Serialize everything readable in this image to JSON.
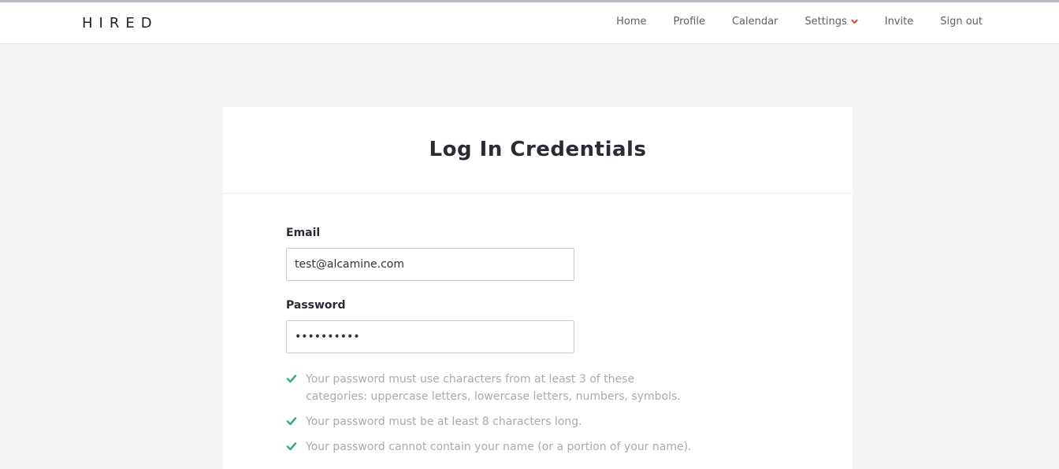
{
  "brand": {
    "logo_text": "HIRED"
  },
  "nav": {
    "items": [
      {
        "label": "Home"
      },
      {
        "label": "Profile"
      },
      {
        "label": "Calendar"
      },
      {
        "label": "Settings",
        "has_dropdown": true
      },
      {
        "label": "Invite"
      },
      {
        "label": "Sign out"
      }
    ],
    "dropdown_icon": "chevron-down-icon",
    "dropdown_icon_color": "#e0403b"
  },
  "card": {
    "title": "Log In Credentials"
  },
  "form": {
    "email_label": "Email",
    "email_value": "test@alcamine.com",
    "password_label": "Password",
    "password_value": "••••••••••"
  },
  "password_rules": {
    "icon": "check-icon",
    "icon_color": "#2fb38f",
    "items": [
      {
        "text": "Your password must use characters from at least 3 of these categories: uppercase letters, lowercase letters, numbers, symbols."
      },
      {
        "text": "Your password must be at least 8 characters long."
      },
      {
        "text": "Your password cannot contain your name (or a portion of your name)."
      }
    ]
  }
}
